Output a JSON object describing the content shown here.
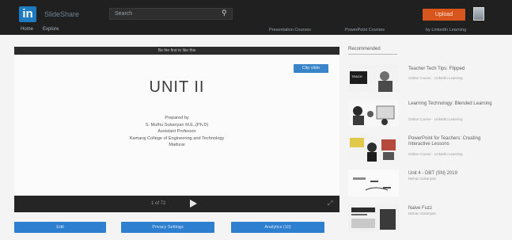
{
  "header": {
    "logo": "in",
    "brand": "SlideShare",
    "search_placeholder": "Search",
    "upload_label": "Upload",
    "nav": {
      "home": "Home",
      "explore": "Explore"
    },
    "links": [
      "Presentation Courses",
      "PowerPoint Courses",
      "by LinkedIn Learning"
    ]
  },
  "player": {
    "notice": "Be the first to like this",
    "clip_label": "Clip slide",
    "title": "UNIT II",
    "credits": [
      "Prepared by",
      "S. Muthu Sukanyan M.E.,(Ph.D)",
      "Assistant Professor",
      "Kamaraj College of Engineering and Technology",
      "Madurai"
    ],
    "page_indicator": "1 of 72",
    "buttons": [
      "Edit",
      "Privacy Settings",
      "Analytics (10)"
    ]
  },
  "sidebar": {
    "heading": "Recommended",
    "items": [
      {
        "title": "Teacher Tech Tips: Flipped",
        "sub": "Online Course · LinkedIn Learning"
      },
      {
        "title": "Learning Technology: Blended Learning",
        "sub": "Online Course · LinkedIn Learning"
      },
      {
        "title": "PowerPoint for Teachers: Creating Interactive Lessons",
        "sub": "Online Course · LinkedIn Learning"
      },
      {
        "title": "Unit 4 - DBT (SN) 2019",
        "sub": "Mohan Sukanyan"
      },
      {
        "title": "Naive Fuzz",
        "sub": "Mohan Sukanyan"
      }
    ]
  },
  "colors": {
    "header_bg": "#202020",
    "upload": "#d9551e",
    "accent_blue": "#2f7fd0",
    "logo_blue": "#1e7bbf"
  }
}
